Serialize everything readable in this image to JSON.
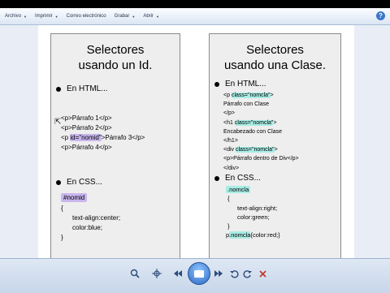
{
  "menubar": {
    "items": [
      "Archivo",
      "Imprimir",
      "Correo electrónico",
      "Grabar",
      "Abrir"
    ],
    "help": "?"
  },
  "slide": {
    "left": {
      "title_line1": "Selectores",
      "title_line2": "usando un Id.",
      "bullet_html": "En HTML...",
      "html_code": {
        "line1": "<p>Párrafo 1</p>",
        "line2": "<p>Párrafo 2</p>",
        "line3_prefix": "<p ",
        "line3_hl": "id=\"nomid\"",
        "line3_suffix": ">Párrafo 3</p>",
        "line4": "<p>Párrafo 4</p>"
      },
      "bullet_css": "En CSS...",
      "css_code": {
        "selector": "#nomid",
        "open": "{",
        "prop1": "text-align:center;",
        "prop2": "color:blue;",
        "close": "}"
      }
    },
    "right": {
      "title_line1": "Selectores",
      "title_line2": "usando una Clase.",
      "bullet_html": "En HTML...",
      "html_code": {
        "l1_prefix": "<p ",
        "l1_hl": "class=\"nomcla\"",
        "l1_suffix": ">",
        "l2": "Párrafo con Clase",
        "l3": "</p>",
        "l4_prefix": "<h1 ",
        "l4_hl": "class=\"nomcla\"",
        "l4_suffix": ">",
        "l5": "Encabezado con Clase",
        "l6": "</h1>",
        "l7_prefix": "<div ",
        "l7_hl": "class=\"nomcla\"",
        "l7_suffix": ">",
        "l8": "<p>Párrafo dentro de Div</p>",
        "l9": "</div>"
      },
      "bullet_css": "En CSS...",
      "css_code": {
        "selector": ".nomcla",
        "open": "{",
        "prop1": "text-align:right;",
        "prop2": "color:green;",
        "close": "}",
        "last_prefix": "p",
        "last_hl": ".nomcla",
        "last_suffix": "{color:red;}"
      }
    }
  },
  "colors": {
    "highlight_purple": "#c8b6ee",
    "highlight_cyan": "#a7ece5",
    "toolbar": "#dbe6f4"
  },
  "toolbar_icons": [
    "zoom-icon",
    "fit-icon",
    "prev-icon",
    "slideshow-icon",
    "next-icon",
    "rotate-left-icon",
    "rotate-right-icon",
    "delete-icon"
  ]
}
